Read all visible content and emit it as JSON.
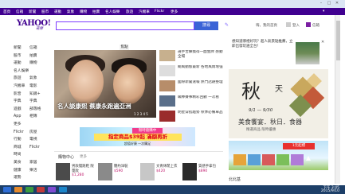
{
  "browser": {
    "controls": [
      "–",
      "□",
      "✕"
    ]
  },
  "topnav": {
    "items": [
      "首頁",
      "信箱",
      "新聞",
      "股市",
      "運動",
      "氣象",
      "購物",
      "拍賣",
      "名人娛樂",
      "旅遊",
      "汽機車",
      "Flickr",
      "更多"
    ],
    "right": "▾"
  },
  "header": {
    "logo": "YAHOO!",
    "logo_sub": "奇摩",
    "search_value": "",
    "search_button": "搜尋",
    "user_text": "嗨，我的首頁",
    "account_text": "登入",
    "mail_label": "信箱"
  },
  "sidebar": {
    "rows": [
      {
        "a": "新聞",
        "b": "信箱"
      },
      {
        "a": "股市",
        "b": "拍賣"
      },
      {
        "a": "運動",
        "b": "購物"
      },
      {
        "a": "名人娛樂",
        "b": ""
      },
      {
        "a": "旅遊",
        "b": "氣象"
      },
      {
        "a": "汽機車",
        "b": "電影"
      },
      {
        "a": "影音",
        "b": "知識+"
      },
      {
        "a": "字典",
        "b": "字典"
      },
      {
        "a": "遊戲",
        "b": "部落格"
      },
      {
        "a": "App",
        "b": "相簿"
      },
      {
        "a": "更多",
        "b": ""
      },
      {
        "a": "Flickr",
        "b": "房屋"
      },
      {
        "a": "行動",
        "b": "電視"
      },
      {
        "a": "商城",
        "b": "Flickr"
      },
      {
        "a": "時尚",
        "b": ""
      },
      {
        "a": "美食",
        "b": "家居"
      },
      {
        "a": "健康",
        "b": "樂活"
      },
      {
        "a": "運勢",
        "b": ""
      }
    ]
  },
  "hero": {
    "tab": "焦點",
    "caption": "名人談康熙 蔡康永跑遍亞洲",
    "dots": "1 2 3 4 5"
  },
  "news": [
    {
      "text": "選手苦練換得一面金牌 感動全場",
      "color": "#c7b08e"
    },
    {
      "text": "颱風動態最新 各地風雨增強",
      "color": "#ddd"
    },
    {
      "text": "國際新聞速報 熱門話題整理",
      "color": "#b78d6a"
    },
    {
      "text": "職棒賽事精彩回顧 一次看",
      "color": "#5a6f8a"
    },
    {
      "text": "明星穿搭趨勢 秋季必備單品",
      "color": "#9a2c2c"
    }
  ],
  "midbanner": {
    "tag": "限時搶購中",
    "headline": "指定商品$39起 滿額再折",
    "sub": "超值好康 一次購足"
  },
  "shopping": {
    "label": "購物中心",
    "more": "更多",
    "products": [
      {
        "name": "男款慢跑鞋 限量款",
        "price": "$1,280",
        "color": "#4b4b4b"
      },
      {
        "name": "簡約洋裝",
        "price": "$590",
        "color": "#8a8a8a"
      },
      {
        "name": "文青休閒上衣",
        "price": "$420",
        "color": "#c7c7c7"
      },
      {
        "name": "質感手拿包",
        "price": "$890",
        "color": "#2b2b2b"
      }
    ]
  },
  "ads": {
    "top_text": "想知道哪裡好玩？超人氣景點推薦，立即出發玩遍全台！",
    "close": "✕",
    "autumn_big": "秋",
    "autumn_tian": "天",
    "autumn_date": "9/1 — 9/30",
    "autumn_title": "美食饗宴．秋日．食器",
    "autumn_sub": "精選商品 限時優惠",
    "houses_badge": "1元起標",
    "bottom": "北北基"
  },
  "taskbar": {
    "time": "下午 3:45",
    "date": "2015/9/10",
    "icons": [
      "#2f6ed6",
      "#e58a2c",
      "#3b9c3e",
      "#c23a3a",
      "#7f4bd1",
      "#1b85c9"
    ]
  },
  "colors": {
    "brand": "#400090",
    "accent": "#3a63d6",
    "link": "#c01a6d"
  }
}
